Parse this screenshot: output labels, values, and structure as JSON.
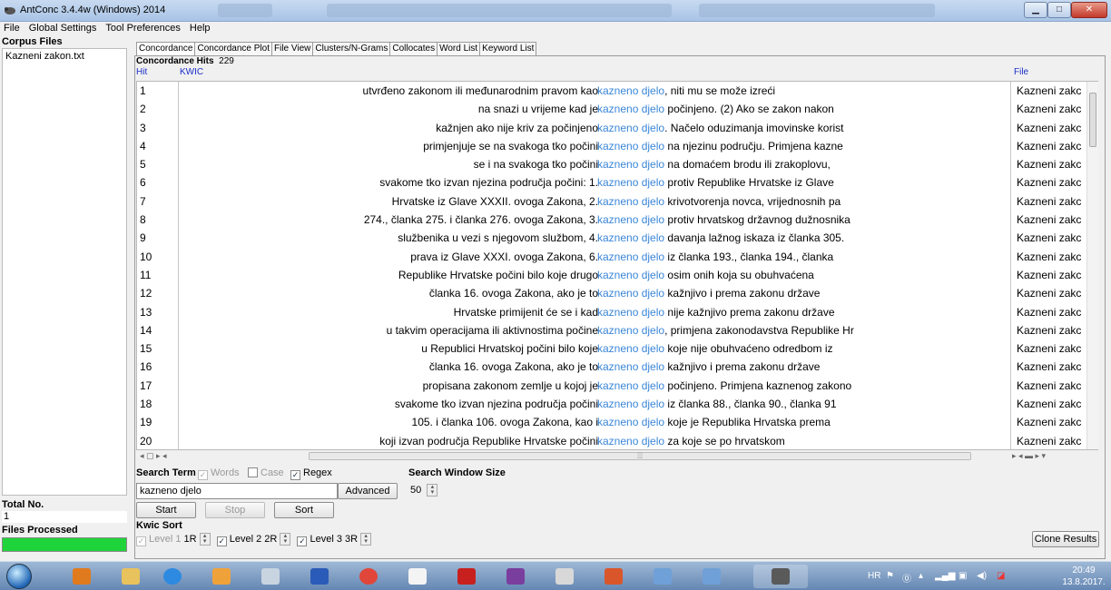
{
  "window": {
    "title": "AntConc 3.4.4w (Windows) 2014"
  },
  "menu": [
    "File",
    "Global Settings",
    "Tool Preferences",
    "Help"
  ],
  "sidebar": {
    "corpus_files_label": "Corpus Files",
    "files": [
      "Kazneni zakon.txt"
    ],
    "total_label": "Total No.",
    "total_value": "1",
    "files_processed_label": "Files Processed",
    "files_processed_progress": 1.0
  },
  "tabs": [
    "Concordance",
    "Concordance Plot",
    "File View",
    "Clusters/N-Grams",
    "Collocates",
    "Word List",
    "Keyword List"
  ],
  "concordance": {
    "hits_label": "Concordance Hits",
    "hits_count": "229",
    "col_hit": "Hit",
    "col_kwic": "KWIC",
    "col_file": "File",
    "keyword": "kazneno djelo",
    "rows": [
      {
        "n": "1",
        "left": "utvrđeno zakonom ili međunarodnim pravom kao",
        "right": ", niti mu se može izreći",
        "file": "Kazneni zakc"
      },
      {
        "n": "2",
        "left": "na snazi u vrijeme kad je",
        "right": " počinjeno. (2) Ako se zakon nakon",
        "file": "Kazneni zakc"
      },
      {
        "n": "3",
        "left": "kažnjen ako nije kriv za počinjeno",
        "right": ".  Načelo oduzimanja imovinske korist",
        "file": "Kazneni zakc"
      },
      {
        "n": "4",
        "left": "primjenjuje se na svakoga tko počini",
        "right": " na njezinu području.  Primjena kazne",
        "file": "Kazneni zakc"
      },
      {
        "n": "5",
        "left": "se i na svakoga tko počini",
        "right": " na domaćem brodu ili zrakoplovu,",
        "file": "Kazneni zakc"
      },
      {
        "n": "6",
        "left": "svakome tko izvan njezina područja počini: 1.",
        "right": " protiv Republike Hrvatske iz Glave",
        "file": "Kazneni zakc"
      },
      {
        "n": "7",
        "left": "Hrvatske iz Glave XXXII. ovoga Zakona, 2.",
        "right": " krivotvorenja novca, vrijednosnih pa",
        "file": "Kazneni zakc"
      },
      {
        "n": "8",
        "left": "274., članka 275. i članka 276. ovoga Zakona, 3.",
        "right": " protiv hrvatskog državnog dužnosnika",
        "file": "Kazneni zakc"
      },
      {
        "n": "9",
        "left": "službenika u vezi s njegovom službom, 4.",
        "right": " davanja lažnog iskaza iz članka 305.",
        "file": "Kazneni zakc"
      },
      {
        "n": "10",
        "left": "prava iz Glave XXXI. ovoga Zakona, 6.",
        "right": " iz članka 193., članka 194., članka",
        "file": "Kazneni zakc"
      },
      {
        "n": "11",
        "left": "Republike Hrvatske počini bilo koje drugo",
        "right": " osim onih koja su obuhvaćena",
        "file": "Kazneni zakc"
      },
      {
        "n": "12",
        "left": "članka 16. ovoga Zakona, ako je to",
        "right": " kažnjivo i prema zakonu države",
        "file": "Kazneni zakc"
      },
      {
        "n": "13",
        "left": "Hrvatske primijenit će se i kad",
        "right": " nije kažnjivo prema zakonu države",
        "file": "Kazneni zakc"
      },
      {
        "n": "14",
        "left": "u takvim operacijama ili aktivnostima počine",
        "right": ", primjena zakonodavstva Republike Hr",
        "file": "Kazneni zakc"
      },
      {
        "n": "15",
        "left": "u Republici Hrvatskoj počini bilo koje",
        "right": " koje nije obuhvaćeno odredbom iz",
        "file": "Kazneni zakc"
      },
      {
        "n": "16",
        "left": "članka 16. ovoga Zakona, ako je to",
        "right": " kažnjivo i prema zakonu države",
        "file": "Kazneni zakc"
      },
      {
        "n": "17",
        "left": "propisana zakonom zemlje u kojoj je",
        "right": " počinjeno.  Primjena kaznenog zakono",
        "file": "Kazneni zakc"
      },
      {
        "n": "18",
        "left": "svakome tko izvan njezina područja počini",
        "right": " iz članka 88., članka 90., članka 91",
        "file": "Kazneni zakc"
      },
      {
        "n": "19",
        "left": "105. i članka 106. ovoga Zakona, kao i",
        "right": " koje je Republika Hrvatska prema",
        "file": "Kazneni zakc"
      },
      {
        "n": "20",
        "left": "koji izvan područja Republike Hrvatske počini",
        "right": " za koje se po hrvatskom",
        "file": "Kazneni zakc"
      }
    ]
  },
  "search": {
    "term_label": "Search Term",
    "words_label": "Words",
    "case_label": "Case",
    "regex_label": "Regex",
    "window_size_label": "Search Window Size",
    "window_size_value": "50",
    "term_value": "kazneno djelo",
    "advanced_label": "Advanced",
    "start_label": "Start",
    "stop_label": "Stop",
    "sort_label": "Sort"
  },
  "kwic_sort": {
    "label": "Kwic Sort",
    "levels": [
      {
        "label": "Level 1",
        "value": "1R"
      },
      {
        "label": "Level 2",
        "value": "2R"
      },
      {
        "label": "Level 3",
        "value": "3R"
      }
    ]
  },
  "clone_results_label": "Clone Results",
  "tray": {
    "lang": "HR",
    "time": "20:49",
    "date": "13.8.2017."
  },
  "colors": {
    "keyword": "#3a86d8",
    "progress": "#1fd43a",
    "header_text": "#1b2fc7"
  }
}
